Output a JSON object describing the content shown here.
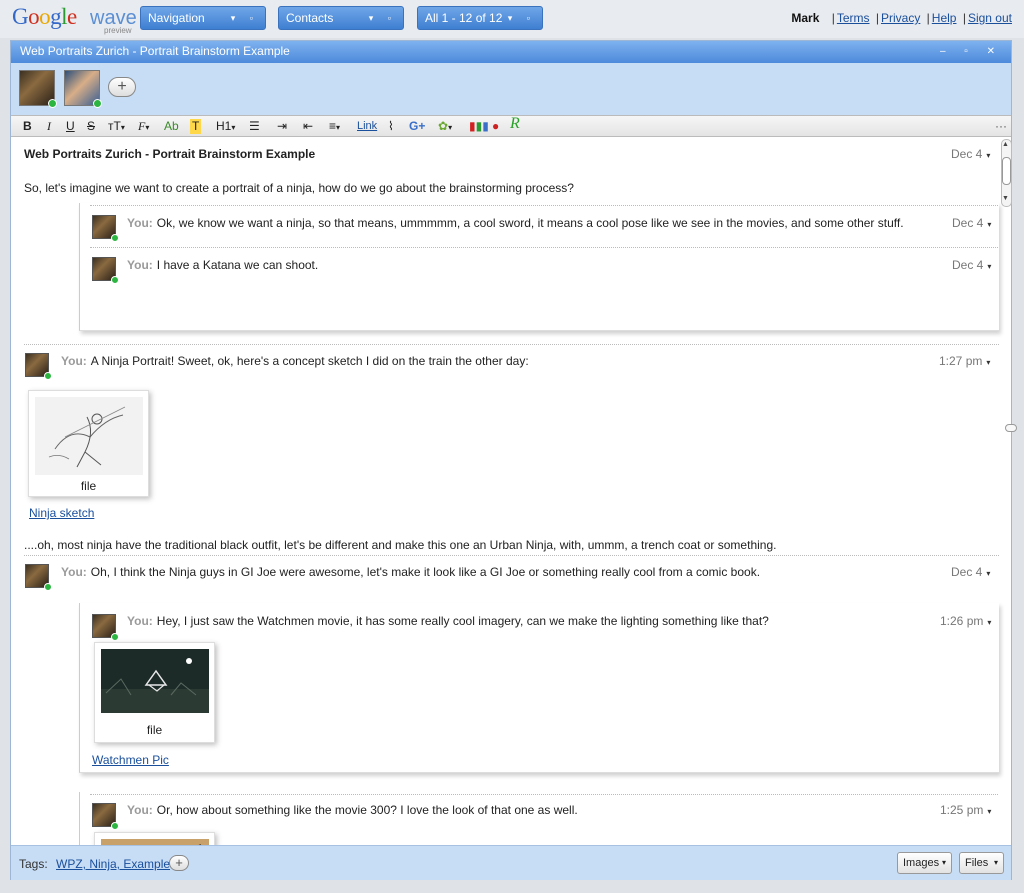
{
  "logo": {
    "word": "Google",
    "product": "wave",
    "badge": "preview"
  },
  "topnav": {
    "navigation": "Navigation",
    "contacts": "Contacts",
    "inbox": "All 1 - 12 of 12"
  },
  "user": {
    "name": "Mark",
    "links": [
      "Terms",
      "Privacy",
      "Help",
      "Sign out"
    ],
    "separator": "|"
  },
  "wave": {
    "title": "Web Portraits Zurich - Portrait Brainstorm Example",
    "window_controls": "– ▫ ✕",
    "add_participant": "+"
  },
  "toolbar": {
    "bold": "B",
    "italic": "I",
    "underline": "U",
    "strike": "S",
    "font_size": "тT",
    "font_family": "F",
    "color": "Ab",
    "highlight": "T",
    "heading": "H1",
    "bullets": "☰",
    "indent": "⇥",
    "outdent": "⇤",
    "align": "≡",
    "link": "Link",
    "attach": "⌇",
    "gadget_g": "G+",
    "puzzle": "✿",
    "colors": "▮▮▮",
    "map_pin": "●",
    "r_icon": "R",
    "more": "···",
    "dropdown_arrow": "▾"
  },
  "blips": {
    "root_title": "Web Portraits Zurich - Portrait Brainstorm Example",
    "root_time": "Dec 4",
    "root_text": "So, let's imagine we want to create a portrait of a ninja, how do we go about the brainstorming process?",
    "r1": {
      "author": "You:",
      "text": "Ok, we know we want a ninja, so that means, ummmmm, a cool sword, it means a cool pose like we see in the movies, and some other stuff.",
      "time": "Dec 4"
    },
    "r2": {
      "author": "You:",
      "text": "I have a Katana we can shoot.",
      "time": "Dec 4"
    },
    "b3": {
      "author": "You:",
      "text": "A Ninja Portrait!  Sweet, ok, here's a concept sketch I did on the train the other day:",
      "time": "1:27 pm"
    },
    "sketch": {
      "caption": "file",
      "link": "Ninja sketch"
    },
    "b3_more": "....oh, most ninja have the traditional black outfit, let's be different and make this one an Urban Ninja, with, ummm, a trench coat or something.",
    "b4": {
      "author": "You:",
      "text": "Oh, I think the Ninja guys in GI Joe were awesome, let's make it look like a GI Joe or something really cool from a comic book.",
      "time": "Dec 4"
    },
    "r4a": {
      "author": "You:",
      "text": "Hey, I just saw the Watchmen movie, it has some really cool imagery, can we make the lighting something like that?",
      "time": "1:26 pm"
    },
    "watchmen": {
      "caption": "file",
      "link": "Watchmen Pic"
    },
    "r4b": {
      "author": "You:",
      "text": "Or, how about something like the movie 300? I love the look of that one as well.",
      "time": "1:25 pm"
    }
  },
  "footer": {
    "tags_label": "Tags:",
    "tags": "WPZ, Ninja, Example",
    "add_tag": "+",
    "images_btn": "Images",
    "files_btn": "Files"
  }
}
